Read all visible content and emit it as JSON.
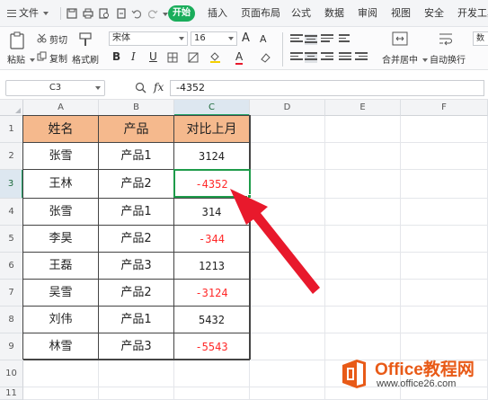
{
  "menubar": {
    "file_label": "文件",
    "tabs": [
      "开始",
      "插入",
      "页面布局",
      "公式",
      "数据",
      "审阅",
      "视图",
      "安全",
      "开发工具"
    ]
  },
  "ribbon": {
    "paste_label": "粘贴",
    "cut_label": "剪切",
    "copy_label": "复制",
    "format_painter_label": "格式刷",
    "font_name": "宋体",
    "font_size": "16",
    "grow_font": "A",
    "shrink_font": "A",
    "bold": "B",
    "italic": "I",
    "underline": "U",
    "font_color_glyph": "A",
    "merge_center_label": "合并居中",
    "wrap_text_label": "自动换行",
    "number_format_glyph": "数"
  },
  "formula_bar": {
    "name_box": "C3",
    "fx_label": "fx",
    "value": "-4352"
  },
  "sheet": {
    "columns": [
      "A",
      "B",
      "C",
      "D",
      "E",
      "F"
    ],
    "rows": [
      "1",
      "2",
      "3",
      "4",
      "5",
      "6",
      "7",
      "8",
      "9",
      "10",
      "11"
    ],
    "headers": [
      "姓名",
      "产品",
      "对比上月"
    ],
    "data": [
      [
        "张雪",
        "产品1",
        "3124"
      ],
      [
        "王林",
        "产品2",
        "-4352"
      ],
      [
        "张雪",
        "产品1",
        "314"
      ],
      [
        "李昊",
        "产品2",
        "-344"
      ],
      [
        "王磊",
        "产品3",
        "1213"
      ],
      [
        "吴雪",
        "产品2",
        "-3124"
      ],
      [
        "刘伟",
        "产品1",
        "5432"
      ],
      [
        "林雪",
        "产品3",
        "-5543"
      ]
    ],
    "selected_cell": "C3"
  },
  "watermark": {
    "title": "Office教程网",
    "url": "www.office26.com"
  },
  "colors": {
    "accent_green": "#1aad5b",
    "header_fill": "#f5b98d",
    "negative_red": "#ff2a2a",
    "arrow_red": "#e8192c",
    "watermark_orange": "#e85a17"
  }
}
